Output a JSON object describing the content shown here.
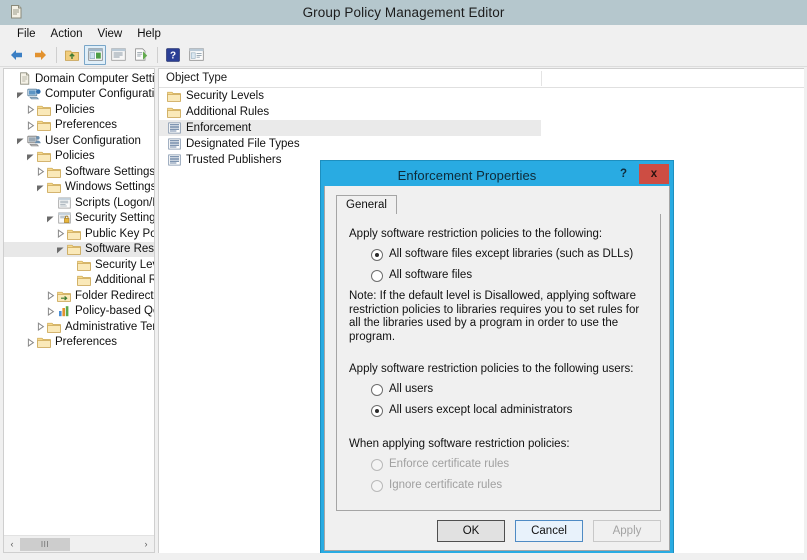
{
  "window": {
    "title": "Group Policy Management Editor",
    "icon": "console-document-icon"
  },
  "menubar": {
    "items": [
      {
        "label": "File",
        "name": "menu-file"
      },
      {
        "label": "Action",
        "name": "menu-action"
      },
      {
        "label": "View",
        "name": "menu-view"
      },
      {
        "label": "Help",
        "name": "menu-help"
      }
    ]
  },
  "toolbar": {
    "buttons": [
      {
        "name": "back-button",
        "icon": "back-arrow-icon",
        "selected": false
      },
      {
        "name": "forward-button",
        "icon": "forward-arrow-icon",
        "selected": false
      },
      {
        "name": "up-folder-button",
        "icon": "up-folder-icon",
        "selected": false
      },
      {
        "name": "show-hide-tree-button",
        "icon": "console-tree-icon",
        "selected": true
      },
      {
        "name": "properties-button",
        "icon": "properties-icon",
        "selected": false
      },
      {
        "name": "export-list-button",
        "icon": "export-list-icon",
        "selected": false
      },
      {
        "name": "help-button",
        "icon": "help-question-icon",
        "selected": false
      },
      {
        "name": "view-options-button",
        "icon": "view-options-icon",
        "selected": false
      }
    ]
  },
  "tree": {
    "items": [
      {
        "label": "Domain Computer Settings",
        "indent": 0,
        "arrow": "none",
        "icon": "console-root-icon",
        "selected": false
      },
      {
        "label": "Computer Configuration",
        "indent": 1,
        "arrow": "expanded",
        "icon": "computer-config-icon",
        "selected": false
      },
      {
        "label": "Policies",
        "indent": 2,
        "arrow": "collapsed",
        "icon": "folder-icon",
        "selected": false
      },
      {
        "label": "Preferences",
        "indent": 2,
        "arrow": "collapsed",
        "icon": "folder-icon",
        "selected": false
      },
      {
        "label": "User Configuration",
        "indent": 1,
        "arrow": "expanded",
        "icon": "user-config-icon",
        "selected": false
      },
      {
        "label": "Policies",
        "indent": 2,
        "arrow": "expanded",
        "icon": "folder-icon",
        "selected": false
      },
      {
        "label": "Software Settings",
        "indent": 3,
        "arrow": "collapsed",
        "icon": "folder-icon",
        "selected": false
      },
      {
        "label": "Windows Settings",
        "indent": 3,
        "arrow": "expanded",
        "icon": "folder-icon",
        "selected": false
      },
      {
        "label": "Scripts (Logon/Logoff)",
        "indent": 4,
        "arrow": "none",
        "icon": "scripts-icon",
        "selected": false
      },
      {
        "label": "Security Settings",
        "indent": 4,
        "arrow": "expanded",
        "icon": "security-settings-icon",
        "selected": false
      },
      {
        "label": "Public Key Policies",
        "indent": 5,
        "arrow": "collapsed",
        "icon": "folder-icon",
        "selected": false
      },
      {
        "label": "Software Restriction Policies",
        "indent": 5,
        "arrow": "expanded",
        "icon": "folder-icon",
        "selected": true
      },
      {
        "label": "Security Levels",
        "indent": 6,
        "arrow": "none",
        "icon": "folder-icon",
        "selected": false
      },
      {
        "label": "Additional Rules",
        "indent": 6,
        "arrow": "none",
        "icon": "folder-icon",
        "selected": false
      },
      {
        "label": "Folder Redirection",
        "indent": 4,
        "arrow": "collapsed",
        "icon": "folder-redirect-icon",
        "selected": false
      },
      {
        "label": "Policy-based QoS",
        "indent": 4,
        "arrow": "collapsed",
        "icon": "qos-chart-icon",
        "selected": false
      },
      {
        "label": "Administrative Templates",
        "indent": 3,
        "arrow": "collapsed",
        "icon": "folder-icon",
        "selected": false
      },
      {
        "label": "Preferences",
        "indent": 2,
        "arrow": "collapsed",
        "icon": "folder-icon",
        "selected": false
      }
    ],
    "scrollbar": {
      "left_arrow": "‹",
      "right_arrow": "›",
      "thumb_grip": "III"
    }
  },
  "list": {
    "columns": [
      "Object Type"
    ],
    "rows": [
      {
        "label": "Security Levels",
        "icon": "folder-icon",
        "selected": false
      },
      {
        "label": "Additional Rules",
        "icon": "folder-icon",
        "selected": false
      },
      {
        "label": "Enforcement",
        "icon": "policy-setting-icon",
        "selected": true
      },
      {
        "label": "Designated File Types",
        "icon": "policy-setting-icon",
        "selected": false
      },
      {
        "label": "Trusted Publishers",
        "icon": "policy-setting-icon",
        "selected": false
      }
    ]
  },
  "dialog": {
    "title": "Enforcement Properties",
    "help_label": "?",
    "close_label": "x",
    "tab_label": "General",
    "group1_caption": "Apply software restriction policies to the following:",
    "group1_options": [
      {
        "label": "All software files except libraries (such as DLLs)",
        "checked": true,
        "disabled": false
      },
      {
        "label": "All software files",
        "checked": false,
        "disabled": false
      }
    ],
    "note": "Note:  If the default level is Disallowed, applying software restriction policies to libraries requires you to set rules for all the libraries used by a program in order to use the program.",
    "group2_caption": "Apply software restriction policies to the following users:",
    "group2_options": [
      {
        "label": "All users",
        "checked": false,
        "disabled": false
      },
      {
        "label": "All users except local administrators",
        "checked": true,
        "disabled": false
      }
    ],
    "group3_caption": "When applying software restriction policies:",
    "group3_options": [
      {
        "label": "Enforce certificate rules",
        "checked": false,
        "disabled": true
      },
      {
        "label": "Ignore certificate rules",
        "checked": false,
        "disabled": true
      }
    ],
    "buttons": [
      {
        "label": "OK",
        "name": "ok-button",
        "style": "primary",
        "disabled": false
      },
      {
        "label": "Cancel",
        "name": "cancel-button",
        "style": "focus",
        "disabled": false
      },
      {
        "label": "Apply",
        "name": "apply-button",
        "style": "dim",
        "disabled": true
      }
    ]
  },
  "colors": {
    "titlebar": "#b5c7cd",
    "dialog_accent": "#29abe2",
    "close_button": "#cd4d43",
    "selection": "#eaeaea"
  }
}
